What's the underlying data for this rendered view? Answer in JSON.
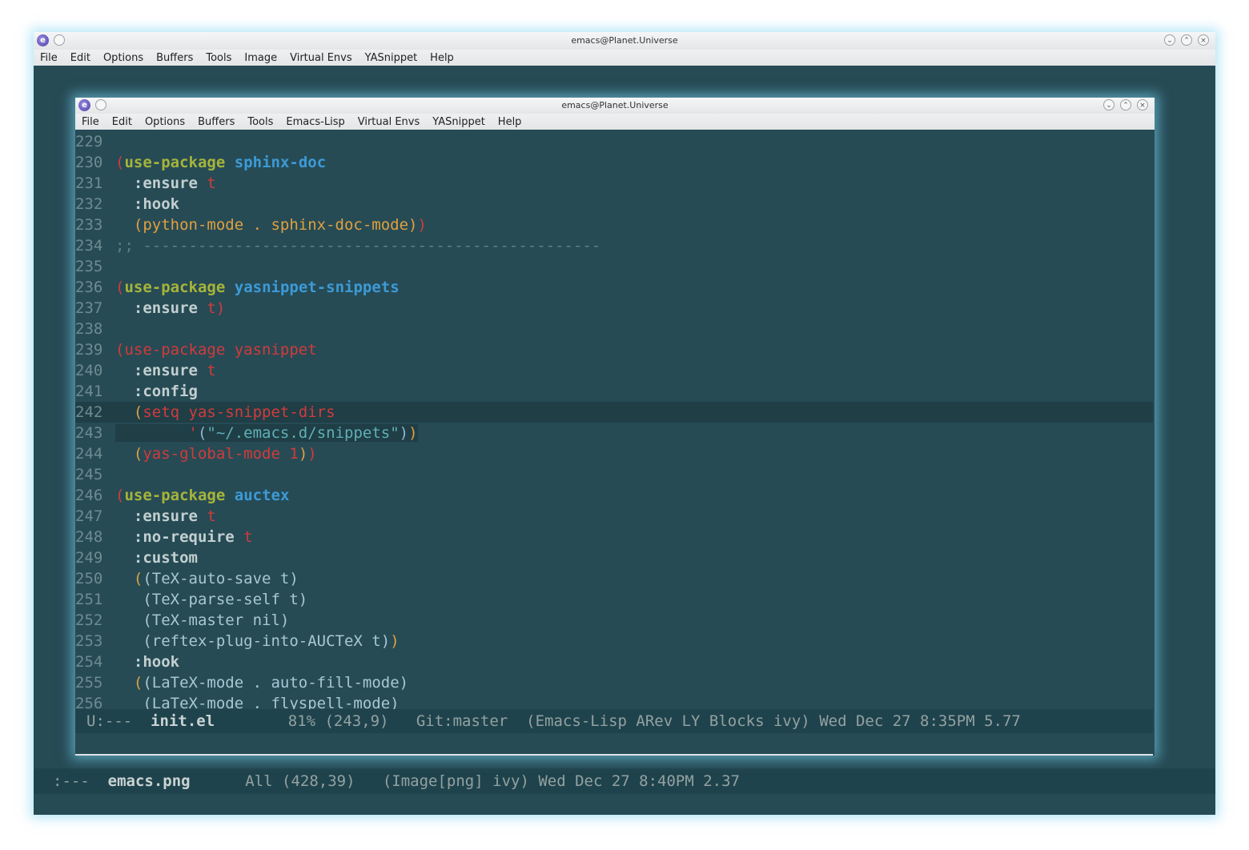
{
  "outer": {
    "title": "emacs@Planet.Universe",
    "menu": [
      "File",
      "Edit",
      "Options",
      "Buffers",
      "Tools",
      "Image",
      "Virtual Envs",
      "YASnippet",
      "Help"
    ],
    "modeline": {
      "status": ":---",
      "buffer": "emacs.png",
      "position": "All (428,39)",
      "modes": "(Image[png] ivy) Wed Dec 27 8:40PM 2.37"
    }
  },
  "inner": {
    "title": "emacs@Planet.Universe",
    "menu": [
      "File",
      "Edit",
      "Options",
      "Buffers",
      "Tools",
      "Emacs-Lisp",
      "Virtual Envs",
      "YASnippet",
      "Help"
    ],
    "lines": [
      {
        "n": "229",
        "segs": []
      },
      {
        "n": "230",
        "segs": [
          {
            "t": "(",
            "c": "c-paren1"
          },
          {
            "t": "use-package",
            "c": "c-kw"
          },
          {
            "t": " "
          },
          {
            "t": "sphinx-doc",
            "c": "c-pkg"
          }
        ]
      },
      {
        "n": "231",
        "segs": [
          {
            "t": "  "
          },
          {
            "t": ":ensure",
            "c": "c-key"
          },
          {
            "t": " "
          },
          {
            "t": "t",
            "c": "c-t"
          }
        ]
      },
      {
        "n": "232",
        "segs": [
          {
            "t": "  "
          },
          {
            "t": ":hook",
            "c": "c-key"
          }
        ]
      },
      {
        "n": "233",
        "segs": [
          {
            "t": "  "
          },
          {
            "t": "(python-mode . sphinx-doc-mode)",
            "c": "c-orange"
          },
          {
            "t": ")",
            "c": "c-paren1"
          }
        ]
      },
      {
        "n": "234",
        "segs": [
          {
            "t": ";; --------------------------------------------------",
            "c": "c-comment"
          }
        ]
      },
      {
        "n": "235",
        "segs": []
      },
      {
        "n": "236",
        "segs": [
          {
            "t": "(",
            "c": "c-paren1"
          },
          {
            "t": "use-package",
            "c": "c-kw"
          },
          {
            "t": " "
          },
          {
            "t": "yasnippet-snippets",
            "c": "c-pkg"
          }
        ]
      },
      {
        "n": "237",
        "segs": [
          {
            "t": "  "
          },
          {
            "t": ":ensure",
            "c": "c-key"
          },
          {
            "t": " "
          },
          {
            "t": "t)",
            "c": "c-t"
          }
        ]
      },
      {
        "n": "238",
        "segs": []
      },
      {
        "n": "239",
        "segs": [
          {
            "t": "(use-package yasnippet",
            "c": "c-red"
          }
        ]
      },
      {
        "n": "240",
        "segs": [
          {
            "t": "  "
          },
          {
            "t": ":ensure",
            "c": "c-key"
          },
          {
            "t": " "
          },
          {
            "t": "t",
            "c": "c-t"
          }
        ]
      },
      {
        "n": "241",
        "segs": [
          {
            "t": "  "
          },
          {
            "t": ":config",
            "c": "c-key"
          }
        ]
      },
      {
        "n": "242",
        "hl": "full",
        "segs": [
          {
            "t": "  "
          },
          {
            "t": "(",
            "c": "c-orange"
          },
          {
            "t": "setq yas-snippet-dirs",
            "c": "c-red"
          }
        ]
      },
      {
        "n": "243",
        "hl": "part",
        "segs": [
          {
            "t": "        "
          },
          {
            "t": "'",
            "c": "c-quote"
          },
          {
            "t": "(",
            "c": "c-paren3"
          },
          {
            "t": "\"~/.emacs.d/snippets\"",
            "c": "c-str"
          },
          {
            "t": ")",
            "c": "c-paren3"
          },
          {
            "t": ")",
            "c": "c-orange"
          }
        ]
      },
      {
        "n": "244",
        "segs": [
          {
            "t": "  "
          },
          {
            "t": "(",
            "c": "c-orange"
          },
          {
            "t": "yas-global-mode 1",
            "c": "c-red"
          },
          {
            "t": ")",
            "c": "c-orange"
          },
          {
            "t": ")",
            "c": "c-red"
          }
        ]
      },
      {
        "n": "245",
        "segs": []
      },
      {
        "n": "246",
        "segs": [
          {
            "t": "(",
            "c": "c-paren1"
          },
          {
            "t": "use-package",
            "c": "c-kw"
          },
          {
            "t": " "
          },
          {
            "t": "auctex",
            "c": "c-pkg"
          }
        ]
      },
      {
        "n": "247",
        "segs": [
          {
            "t": "  "
          },
          {
            "t": ":ensure",
            "c": "c-key"
          },
          {
            "t": " "
          },
          {
            "t": "t",
            "c": "c-t"
          }
        ]
      },
      {
        "n": "248",
        "segs": [
          {
            "t": "  "
          },
          {
            "t": ":no-require",
            "c": "c-key"
          },
          {
            "t": " "
          },
          {
            "t": "t",
            "c": "c-t"
          }
        ]
      },
      {
        "n": "249",
        "segs": [
          {
            "t": "  "
          },
          {
            "t": ":custom",
            "c": "c-key"
          }
        ]
      },
      {
        "n": "250",
        "segs": [
          {
            "t": "  "
          },
          {
            "t": "(",
            "c": "c-orange"
          },
          {
            "t": "(TeX-auto-save t)",
            "c": "c-plain"
          }
        ]
      },
      {
        "n": "251",
        "segs": [
          {
            "t": "   "
          },
          {
            "t": "(TeX-parse-self t)",
            "c": "c-plain"
          }
        ]
      },
      {
        "n": "252",
        "segs": [
          {
            "t": "   "
          },
          {
            "t": "(TeX-master nil)",
            "c": "c-plain"
          }
        ]
      },
      {
        "n": "253",
        "segs": [
          {
            "t": "   "
          },
          {
            "t": "(reftex-plug-into-AUCTeX t)",
            "c": "c-plain"
          },
          {
            "t": ")",
            "c": "c-orange"
          }
        ]
      },
      {
        "n": "254",
        "segs": [
          {
            "t": "  "
          },
          {
            "t": ":hook",
            "c": "c-key"
          }
        ]
      },
      {
        "n": "255",
        "segs": [
          {
            "t": "  "
          },
          {
            "t": "(",
            "c": "c-orange"
          },
          {
            "t": "(LaTeX-mode . auto-fill-mode)",
            "c": "c-plain"
          }
        ]
      },
      {
        "n": "256",
        "segs": [
          {
            "t": "   "
          },
          {
            "t": "(LaTeX-mode . flyspell-mode)",
            "c": "c-plain"
          }
        ]
      }
    ],
    "modeline": {
      "status": "U:---",
      "buffer": "init.el",
      "position": "81% (243,9)",
      "vc": "Git:master",
      "modes": "(Emacs-Lisp ARev LY Blocks ivy) Wed Dec 27 8:35PM 5.77"
    }
  }
}
